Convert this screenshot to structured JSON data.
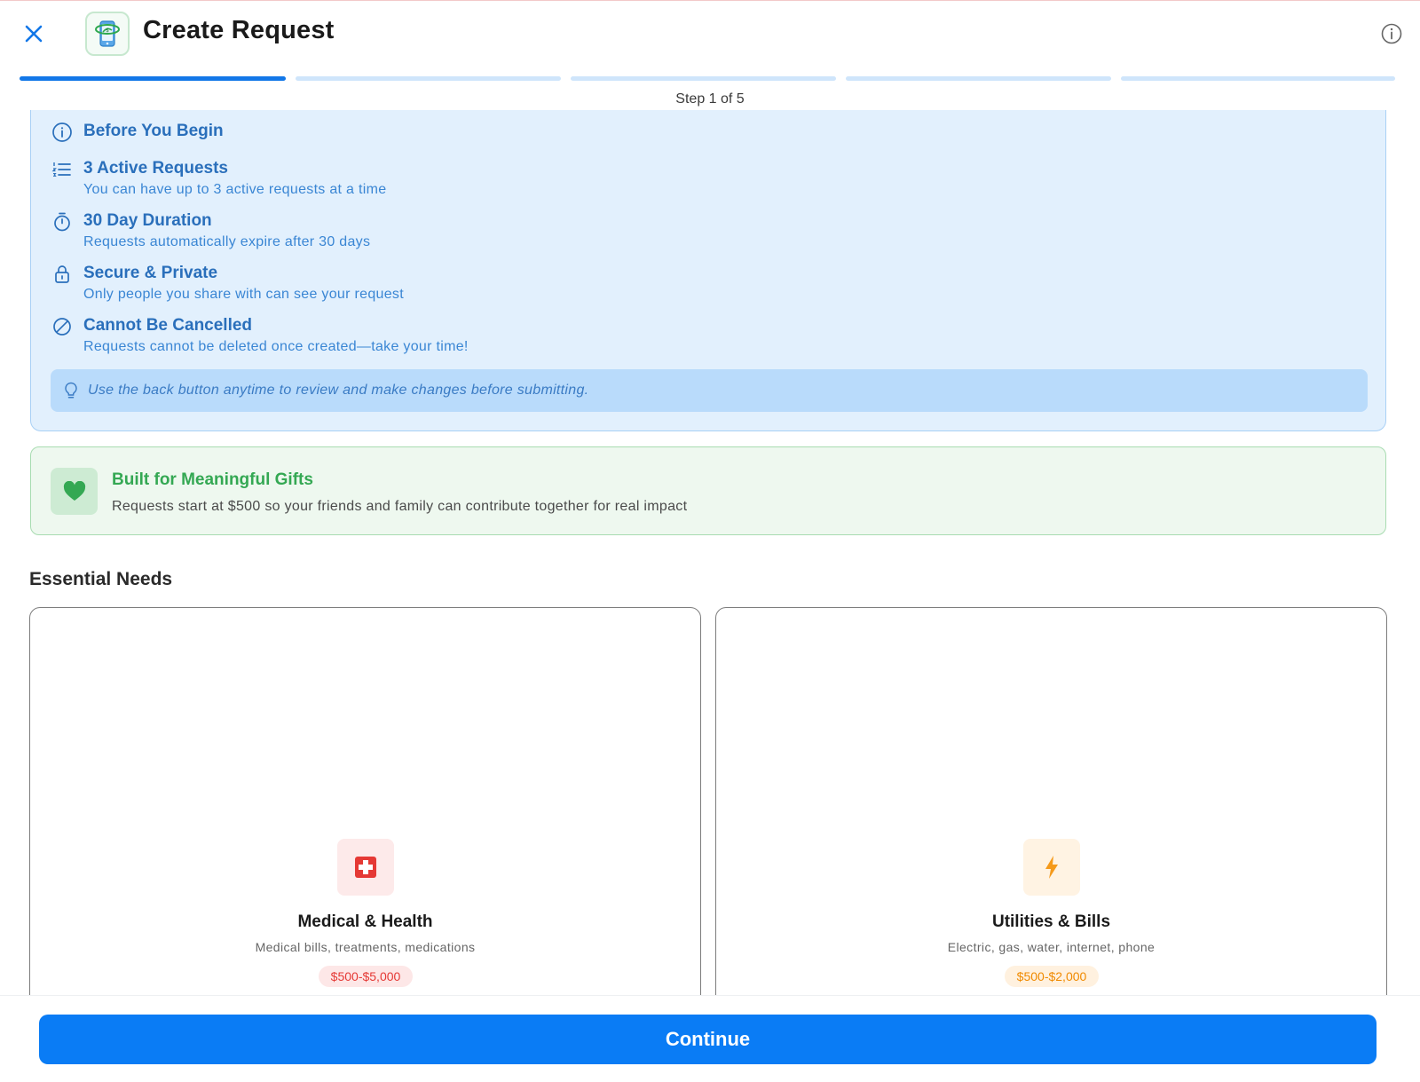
{
  "header": {
    "title": "Create Request",
    "close_icon": "close-icon",
    "info_icon": "info-icon",
    "logo_icon": "phone-globe-logo"
  },
  "progress": {
    "current_step": 1,
    "total_steps": 5,
    "label": "Step 1 of 5",
    "active_color": "#1277e8",
    "inactive_color": "#cfe5fb"
  },
  "before_you_begin": {
    "heading": "Before You Begin",
    "items": [
      {
        "icon": "list-icon",
        "title": "3 Active Requests",
        "subtitle": "You can have up to 3 active requests at a time"
      },
      {
        "icon": "timer-icon",
        "title": "30 Day Duration",
        "subtitle": "Requests automatically expire after 30 days"
      },
      {
        "icon": "lock-icon",
        "title": "Secure & Private",
        "subtitle": "Only people you share with can see your request"
      },
      {
        "icon": "ban-icon",
        "title": "Cannot Be Cancelled",
        "subtitle": "Requests cannot be deleted once created—take your time!"
      }
    ],
    "tip": "Use the back button anytime to review and make changes before submitting."
  },
  "gift_banner": {
    "icon": "heart-icon",
    "title": "Built for Meaningful Gifts",
    "subtitle": "Requests start at $500 so your friends and family can contribute together for real impact"
  },
  "essential_needs": {
    "heading": "Essential Needs",
    "categories": [
      {
        "icon": "medical-cross-icon",
        "name": "Medical & Health",
        "description": "Medical bills, treatments, medications",
        "range": "$500-$5,000",
        "accent": "#e53935"
      },
      {
        "icon": "lightning-icon",
        "name": "Utilities & Bills",
        "description": "Electric, gas, water, internet, phone",
        "range": "$500-$2,000",
        "accent": "#f59a1b"
      }
    ]
  },
  "footer": {
    "continue_label": "Continue",
    "button_color": "#0a7cf5"
  }
}
